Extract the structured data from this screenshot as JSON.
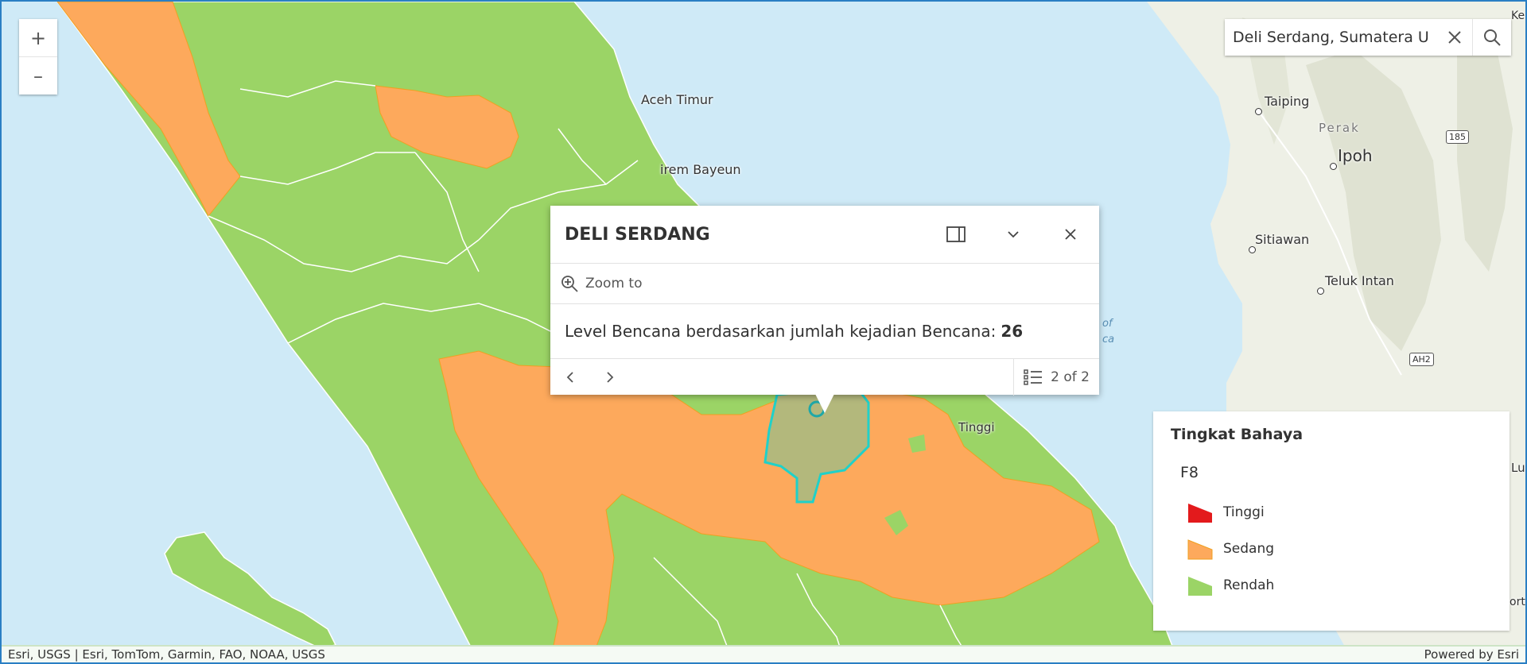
{
  "map": {
    "place_labels": [
      {
        "name": "Aceh Timur"
      },
      {
        "name": "irem Bayeun"
      },
      {
        "name": "Taiping"
      },
      {
        "name": "Perak"
      },
      {
        "name": "Ipoh"
      },
      {
        "name": "Sitiawan"
      },
      {
        "name": "Teluk Intan"
      },
      {
        "name": "Tinggi"
      },
      {
        "name": "of"
      },
      {
        "name": "ca"
      },
      {
        "name": "Ke"
      },
      {
        "name": "Lu"
      },
      {
        "name": "ort"
      }
    ],
    "road_shields": [
      "185",
      "AH2"
    ],
    "fill_colors": {
      "tinggi": "#e31a1c",
      "sedang": "#fda95c",
      "rendah": "#9bd466",
      "selected": "#b3b87c",
      "selected_outline": "#1fd1c9",
      "water": "#cfeaf7"
    }
  },
  "zoom": {
    "in_label": "+",
    "out_label": "–"
  },
  "search": {
    "value": "Deli Serdang, Sumatera U",
    "clear_icon": "close-icon",
    "search_icon": "search-icon"
  },
  "popup": {
    "title": "DELI SERDANG",
    "dock_icon": "dock-icon",
    "collapse_icon": "chevron-down-icon",
    "close_icon": "close-icon",
    "action_label": "Zoom to",
    "content_label": "Level Bencana berdasarkan jumlah kejadian Bencana:",
    "content_value": "26",
    "feature_count": "2 of 2"
  },
  "legend": {
    "title": "Tingkat Bahaya",
    "layer": "F8",
    "items": [
      {
        "label": "Tinggi",
        "color": "#e31a1c"
      },
      {
        "label": "Sedang",
        "color": "#fda95c"
      },
      {
        "label": "Rendah",
        "color": "#9bd466"
      }
    ]
  },
  "attribution": {
    "left": "Esri, USGS | Esri, TomTom, Garmin, FAO, NOAA, USGS",
    "right": "Powered by Esri"
  }
}
